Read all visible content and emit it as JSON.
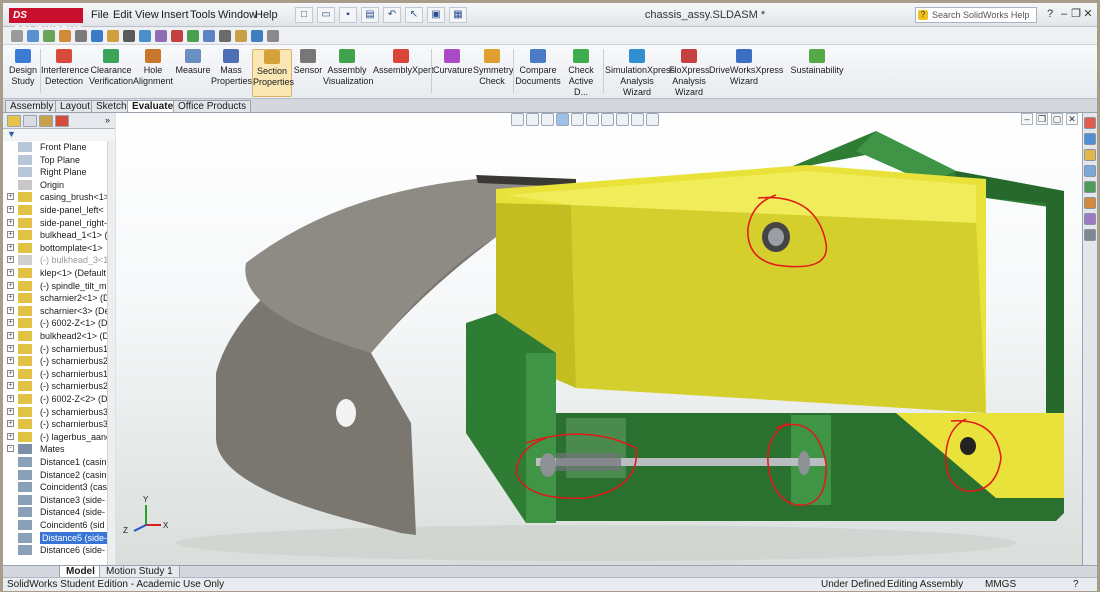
{
  "app": {
    "logo_text": "DS SOLIDWORKS",
    "document_title": "chassis_assy.SLDASM *",
    "help_search_placeholder": "Search SolidWorks Help"
  },
  "menu": [
    "File",
    "Edit",
    "View",
    "Insert",
    "Tools",
    "Window",
    "Help"
  ],
  "toolbar": {
    "tools": [
      {
        "label": "Design Study",
        "icon": "design-study-icon",
        "color": "#3a7bd5"
      },
      {
        "label": "Interference Detection",
        "icon": "interference-icon",
        "color": "#d94a3a"
      },
      {
        "label": "Clearance Verification",
        "icon": "clearance-icon",
        "color": "#3aa55a"
      },
      {
        "label": "Hole Alignment",
        "icon": "hole-alignment-icon",
        "color": "#c9772c"
      },
      {
        "label": "Measure",
        "icon": "measure-icon",
        "color": "#6b8fc2"
      },
      {
        "label": "Mass Properties",
        "icon": "mass-properties-icon",
        "color": "#4e6fb5"
      },
      {
        "label": "Section Properties",
        "icon": "section-properties-icon",
        "color": "#d6a13b"
      },
      {
        "label": "Sensor",
        "icon": "sensor-icon",
        "color": "#777777"
      },
      {
        "label": "Assembly Visualization",
        "icon": "assembly-visualization-icon",
        "color": "#3fa34d"
      },
      {
        "label": "AssemblyXpert",
        "icon": "assemblyxpert-icon",
        "color": "#d9453b"
      },
      {
        "label": "Curvature",
        "icon": "curvature-icon",
        "color": "#a94bc4"
      },
      {
        "label": "Symmetry Check",
        "icon": "symmetry-check-icon",
        "color": "#e0a030"
      },
      {
        "label": "Compare Documents",
        "icon": "compare-documents-icon",
        "color": "#4a7ac9"
      },
      {
        "label": "Check Active D...",
        "icon": "check-active-document-icon",
        "color": "#3cae4e"
      },
      {
        "label": "SimulationXpress Analysis Wizard",
        "icon": "simulationxpress-icon",
        "color": "#2f8fcf"
      },
      {
        "label": "FloXpress Analysis Wizard",
        "icon": "floxpress-icon",
        "color": "#c94040"
      },
      {
        "label": "DriveWorksXpress Wizard",
        "icon": "driveworksxpress-icon",
        "color": "#3b6fc1"
      },
      {
        "label": "Sustainability",
        "icon": "sustainability-icon",
        "color": "#57a846"
      }
    ]
  },
  "tabs": [
    "Assembly",
    "Layout",
    "Sketch",
    "Evaluate",
    "Office Products"
  ],
  "active_tab": "Evaluate",
  "feature_tree": [
    {
      "label": "Front Plane",
      "icon": "plane-icon",
      "expand": ""
    },
    {
      "label": "Top Plane",
      "icon": "plane-icon",
      "expand": ""
    },
    {
      "label": "Right Plane",
      "icon": "plane-icon",
      "expand": ""
    },
    {
      "label": "Origin",
      "icon": "origin-icon",
      "expand": ""
    },
    {
      "label": "casing_brush<1>",
      "icon": "part-icon",
      "expand": "+"
    },
    {
      "label": "side-panel_left<",
      "icon": "part-icon",
      "expand": "+"
    },
    {
      "label": "side-panel_right-",
      "icon": "part-icon",
      "expand": "+"
    },
    {
      "label": "bulkhead_1<1> (",
      "icon": "part-icon",
      "expand": "+"
    },
    {
      "label": "bottomplate<1>",
      "icon": "part-icon",
      "expand": "+"
    },
    {
      "label": "(-) bulkhead_3<1>",
      "icon": "suppressed-part-icon",
      "expand": "+",
      "suppressed": true
    },
    {
      "label": "klep<1> (Default",
      "icon": "part-icon",
      "expand": "+"
    },
    {
      "label": "(-) spindle_tilt_m",
      "icon": "part-icon",
      "expand": "+"
    },
    {
      "label": "scharnier2<1> (D",
      "icon": "part-icon",
      "expand": "+"
    },
    {
      "label": "scharnier<3> (De",
      "icon": "part-icon",
      "expand": "+"
    },
    {
      "label": "(-) 6002-Z<1> (D",
      "icon": "part-icon",
      "expand": "+"
    },
    {
      "label": "bulkhead2<1> (D",
      "icon": "part-icon",
      "expand": "+"
    },
    {
      "label": "(-) scharnierbus1",
      "icon": "part-icon",
      "expand": "+"
    },
    {
      "label": "(-) scharnierbus2",
      "icon": "part-icon",
      "expand": "+"
    },
    {
      "label": "(-) scharnierbus1",
      "icon": "part-icon",
      "expand": "+"
    },
    {
      "label": "(-) scharnierbus2",
      "icon": "part-icon",
      "expand": "+"
    },
    {
      "label": "(-) 6002-Z<2> (D",
      "icon": "part-icon",
      "expand": "+"
    },
    {
      "label": "(-) scharnierbus3",
      "icon": "part-icon",
      "expand": "+"
    },
    {
      "label": "(-) scharnierbus3",
      "icon": "part-icon",
      "expand": "+"
    },
    {
      "label": "(-) lagerbus_aanc",
      "icon": "part-icon",
      "expand": "+"
    },
    {
      "label": "Mates",
      "icon": "mates-icon",
      "expand": "-"
    },
    {
      "label": "Distance1 (casin",
      "icon": "distance-mate-icon",
      "expand": ""
    },
    {
      "label": "Distance2 (casin",
      "icon": "distance-mate-icon",
      "expand": ""
    },
    {
      "label": "Coincident3 (cas",
      "icon": "coincident-mate-icon",
      "expand": ""
    },
    {
      "label": "Distance3 (side-",
      "icon": "distance-mate-icon",
      "expand": ""
    },
    {
      "label": "Distance4 (side-",
      "icon": "distance-mate-icon",
      "expand": ""
    },
    {
      "label": "Coincident6 (sid",
      "icon": "coincident-mate-icon",
      "expand": ""
    },
    {
      "label": "Distance5 (side-",
      "icon": "distance-mate-icon",
      "expand": "",
      "selected": true
    },
    {
      "label": "Distance6 (side-",
      "icon": "distance-mate-icon",
      "expand": ""
    }
  ],
  "bottom_tabs": [
    "Model",
    "Motion Study 1"
  ],
  "status": {
    "left": "SolidWorks Student Edition - Academic Use Only",
    "state": "Under Defined",
    "mode": "Editing Assembly",
    "units": "MMGS",
    "help_glyph": "?"
  },
  "triad": {
    "x_label": "X",
    "y_label": "Y",
    "z_label": "Z"
  },
  "colors": {
    "part_green": "#2f7d35",
    "part_yellow": "#e9e23a",
    "grey_panel": "#7a7670",
    "annotation_red": "#e01818",
    "selection_blue": "#3875d7"
  },
  "window_controls": {
    "minimize": "–",
    "restore": "❐",
    "close": "✕"
  }
}
